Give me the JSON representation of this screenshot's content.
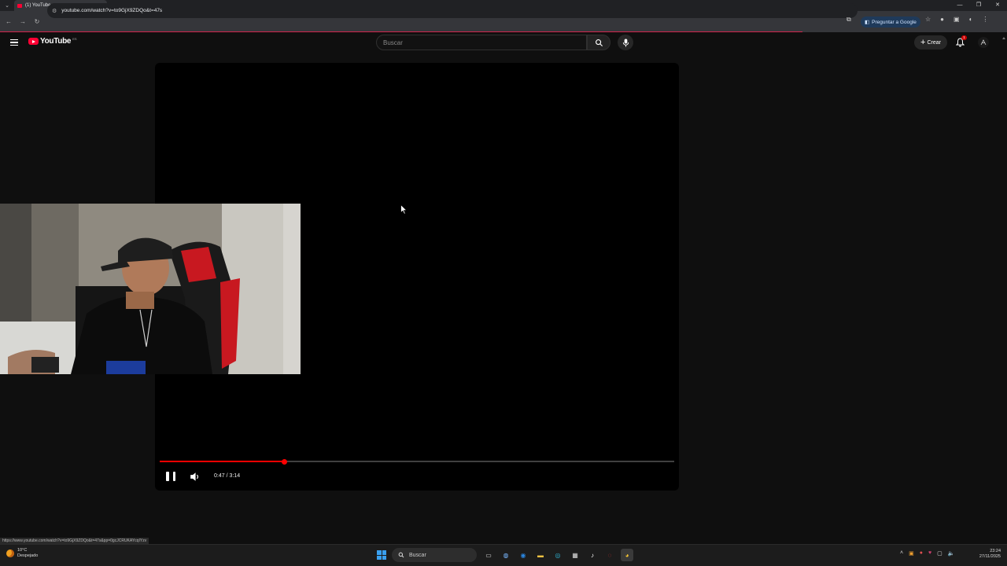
{
  "browser": {
    "tab_title": "(1) YouTube",
    "url": "youtube.com/watch?v=to9GjX9ZDQo&t=47s",
    "ask_google": "Preguntar a Google",
    "status_url": "https://www.youtube.com/watch?v=to9GjX9ZDQo&t=47s&pp=0gcJCRUKAYcqIYzv"
  },
  "youtube": {
    "logo_text": "YouTube",
    "country_code": "ES",
    "search_placeholder": "Buscar",
    "create_label": "Crear",
    "notification_count": "1"
  },
  "player": {
    "time_display": "0:47 / 3:14",
    "progress_fraction": 0.2423,
    "state": "playing"
  },
  "taskbar": {
    "weather_temp": "10°C",
    "weather_desc": "Despejado",
    "search_label": "Buscar",
    "time": "23:24",
    "date": "27/11/2025"
  },
  "colors": {
    "accent_red": "#ff0033",
    "progress_red": "#ff0000",
    "background": "#0f0f0f"
  }
}
